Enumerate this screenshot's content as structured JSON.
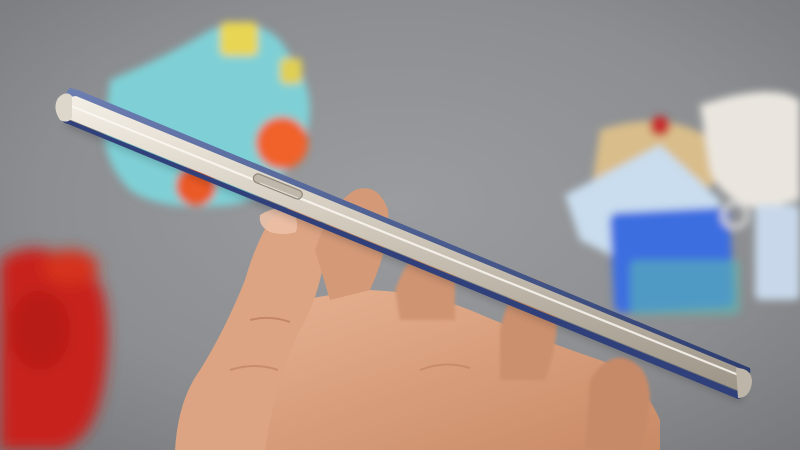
{
  "scene": {
    "subject": "smartphone-side-profile",
    "colors": {
      "background": "#8e9093",
      "phone_frame": "#c9c2b6",
      "phone_frame_highlight": "#efeae1",
      "phone_glass": "#3a4e86",
      "skin": "#d9a07e",
      "toy_body": "#7fd0d6",
      "toy_accent": "#f0622c",
      "yarn": "#c8241c",
      "card_blue": "#3d6ee0",
      "card_white": "#eae6df"
    }
  }
}
